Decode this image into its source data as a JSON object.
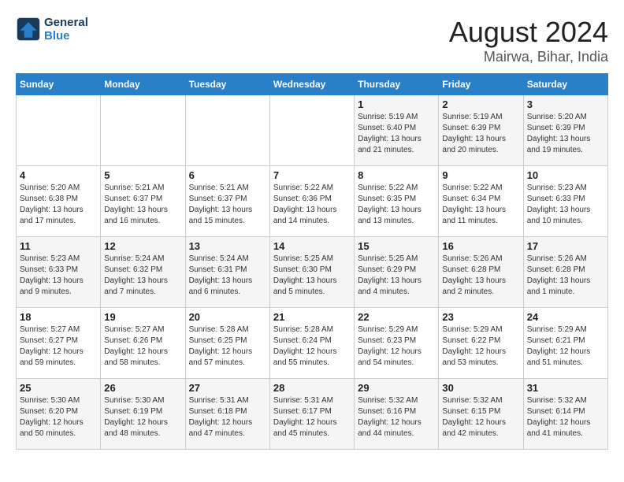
{
  "header": {
    "logo_line1": "General",
    "logo_line2": "Blue",
    "main_title": "August 2024",
    "sub_title": "Mairwa, Bihar, India"
  },
  "days_of_week": [
    "Sunday",
    "Monday",
    "Tuesday",
    "Wednesday",
    "Thursday",
    "Friday",
    "Saturday"
  ],
  "weeks": [
    [
      {
        "num": "",
        "info": ""
      },
      {
        "num": "",
        "info": ""
      },
      {
        "num": "",
        "info": ""
      },
      {
        "num": "",
        "info": ""
      },
      {
        "num": "1",
        "info": "Sunrise: 5:19 AM\nSunset: 6:40 PM\nDaylight: 13 hours\nand 21 minutes."
      },
      {
        "num": "2",
        "info": "Sunrise: 5:19 AM\nSunset: 6:39 PM\nDaylight: 13 hours\nand 20 minutes."
      },
      {
        "num": "3",
        "info": "Sunrise: 5:20 AM\nSunset: 6:39 PM\nDaylight: 13 hours\nand 19 minutes."
      }
    ],
    [
      {
        "num": "4",
        "info": "Sunrise: 5:20 AM\nSunset: 6:38 PM\nDaylight: 13 hours\nand 17 minutes."
      },
      {
        "num": "5",
        "info": "Sunrise: 5:21 AM\nSunset: 6:37 PM\nDaylight: 13 hours\nand 16 minutes."
      },
      {
        "num": "6",
        "info": "Sunrise: 5:21 AM\nSunset: 6:37 PM\nDaylight: 13 hours\nand 15 minutes."
      },
      {
        "num": "7",
        "info": "Sunrise: 5:22 AM\nSunset: 6:36 PM\nDaylight: 13 hours\nand 14 minutes."
      },
      {
        "num": "8",
        "info": "Sunrise: 5:22 AM\nSunset: 6:35 PM\nDaylight: 13 hours\nand 13 minutes."
      },
      {
        "num": "9",
        "info": "Sunrise: 5:22 AM\nSunset: 6:34 PM\nDaylight: 13 hours\nand 11 minutes."
      },
      {
        "num": "10",
        "info": "Sunrise: 5:23 AM\nSunset: 6:33 PM\nDaylight: 13 hours\nand 10 minutes."
      }
    ],
    [
      {
        "num": "11",
        "info": "Sunrise: 5:23 AM\nSunset: 6:33 PM\nDaylight: 13 hours\nand 9 minutes."
      },
      {
        "num": "12",
        "info": "Sunrise: 5:24 AM\nSunset: 6:32 PM\nDaylight: 13 hours\nand 7 minutes."
      },
      {
        "num": "13",
        "info": "Sunrise: 5:24 AM\nSunset: 6:31 PM\nDaylight: 13 hours\nand 6 minutes."
      },
      {
        "num": "14",
        "info": "Sunrise: 5:25 AM\nSunset: 6:30 PM\nDaylight: 13 hours\nand 5 minutes."
      },
      {
        "num": "15",
        "info": "Sunrise: 5:25 AM\nSunset: 6:29 PM\nDaylight: 13 hours\nand 4 minutes."
      },
      {
        "num": "16",
        "info": "Sunrise: 5:26 AM\nSunset: 6:28 PM\nDaylight: 13 hours\nand 2 minutes."
      },
      {
        "num": "17",
        "info": "Sunrise: 5:26 AM\nSunset: 6:28 PM\nDaylight: 13 hours\nand 1 minute."
      }
    ],
    [
      {
        "num": "18",
        "info": "Sunrise: 5:27 AM\nSunset: 6:27 PM\nDaylight: 12 hours\nand 59 minutes."
      },
      {
        "num": "19",
        "info": "Sunrise: 5:27 AM\nSunset: 6:26 PM\nDaylight: 12 hours\nand 58 minutes."
      },
      {
        "num": "20",
        "info": "Sunrise: 5:28 AM\nSunset: 6:25 PM\nDaylight: 12 hours\nand 57 minutes."
      },
      {
        "num": "21",
        "info": "Sunrise: 5:28 AM\nSunset: 6:24 PM\nDaylight: 12 hours\nand 55 minutes."
      },
      {
        "num": "22",
        "info": "Sunrise: 5:29 AM\nSunset: 6:23 PM\nDaylight: 12 hours\nand 54 minutes."
      },
      {
        "num": "23",
        "info": "Sunrise: 5:29 AM\nSunset: 6:22 PM\nDaylight: 12 hours\nand 53 minutes."
      },
      {
        "num": "24",
        "info": "Sunrise: 5:29 AM\nSunset: 6:21 PM\nDaylight: 12 hours\nand 51 minutes."
      }
    ],
    [
      {
        "num": "25",
        "info": "Sunrise: 5:30 AM\nSunset: 6:20 PM\nDaylight: 12 hours\nand 50 minutes."
      },
      {
        "num": "26",
        "info": "Sunrise: 5:30 AM\nSunset: 6:19 PM\nDaylight: 12 hours\nand 48 minutes."
      },
      {
        "num": "27",
        "info": "Sunrise: 5:31 AM\nSunset: 6:18 PM\nDaylight: 12 hours\nand 47 minutes."
      },
      {
        "num": "28",
        "info": "Sunrise: 5:31 AM\nSunset: 6:17 PM\nDaylight: 12 hours\nand 45 minutes."
      },
      {
        "num": "29",
        "info": "Sunrise: 5:32 AM\nSunset: 6:16 PM\nDaylight: 12 hours\nand 44 minutes."
      },
      {
        "num": "30",
        "info": "Sunrise: 5:32 AM\nSunset: 6:15 PM\nDaylight: 12 hours\nand 42 minutes."
      },
      {
        "num": "31",
        "info": "Sunrise: 5:32 AM\nSunset: 6:14 PM\nDaylight: 12 hours\nand 41 minutes."
      }
    ]
  ]
}
